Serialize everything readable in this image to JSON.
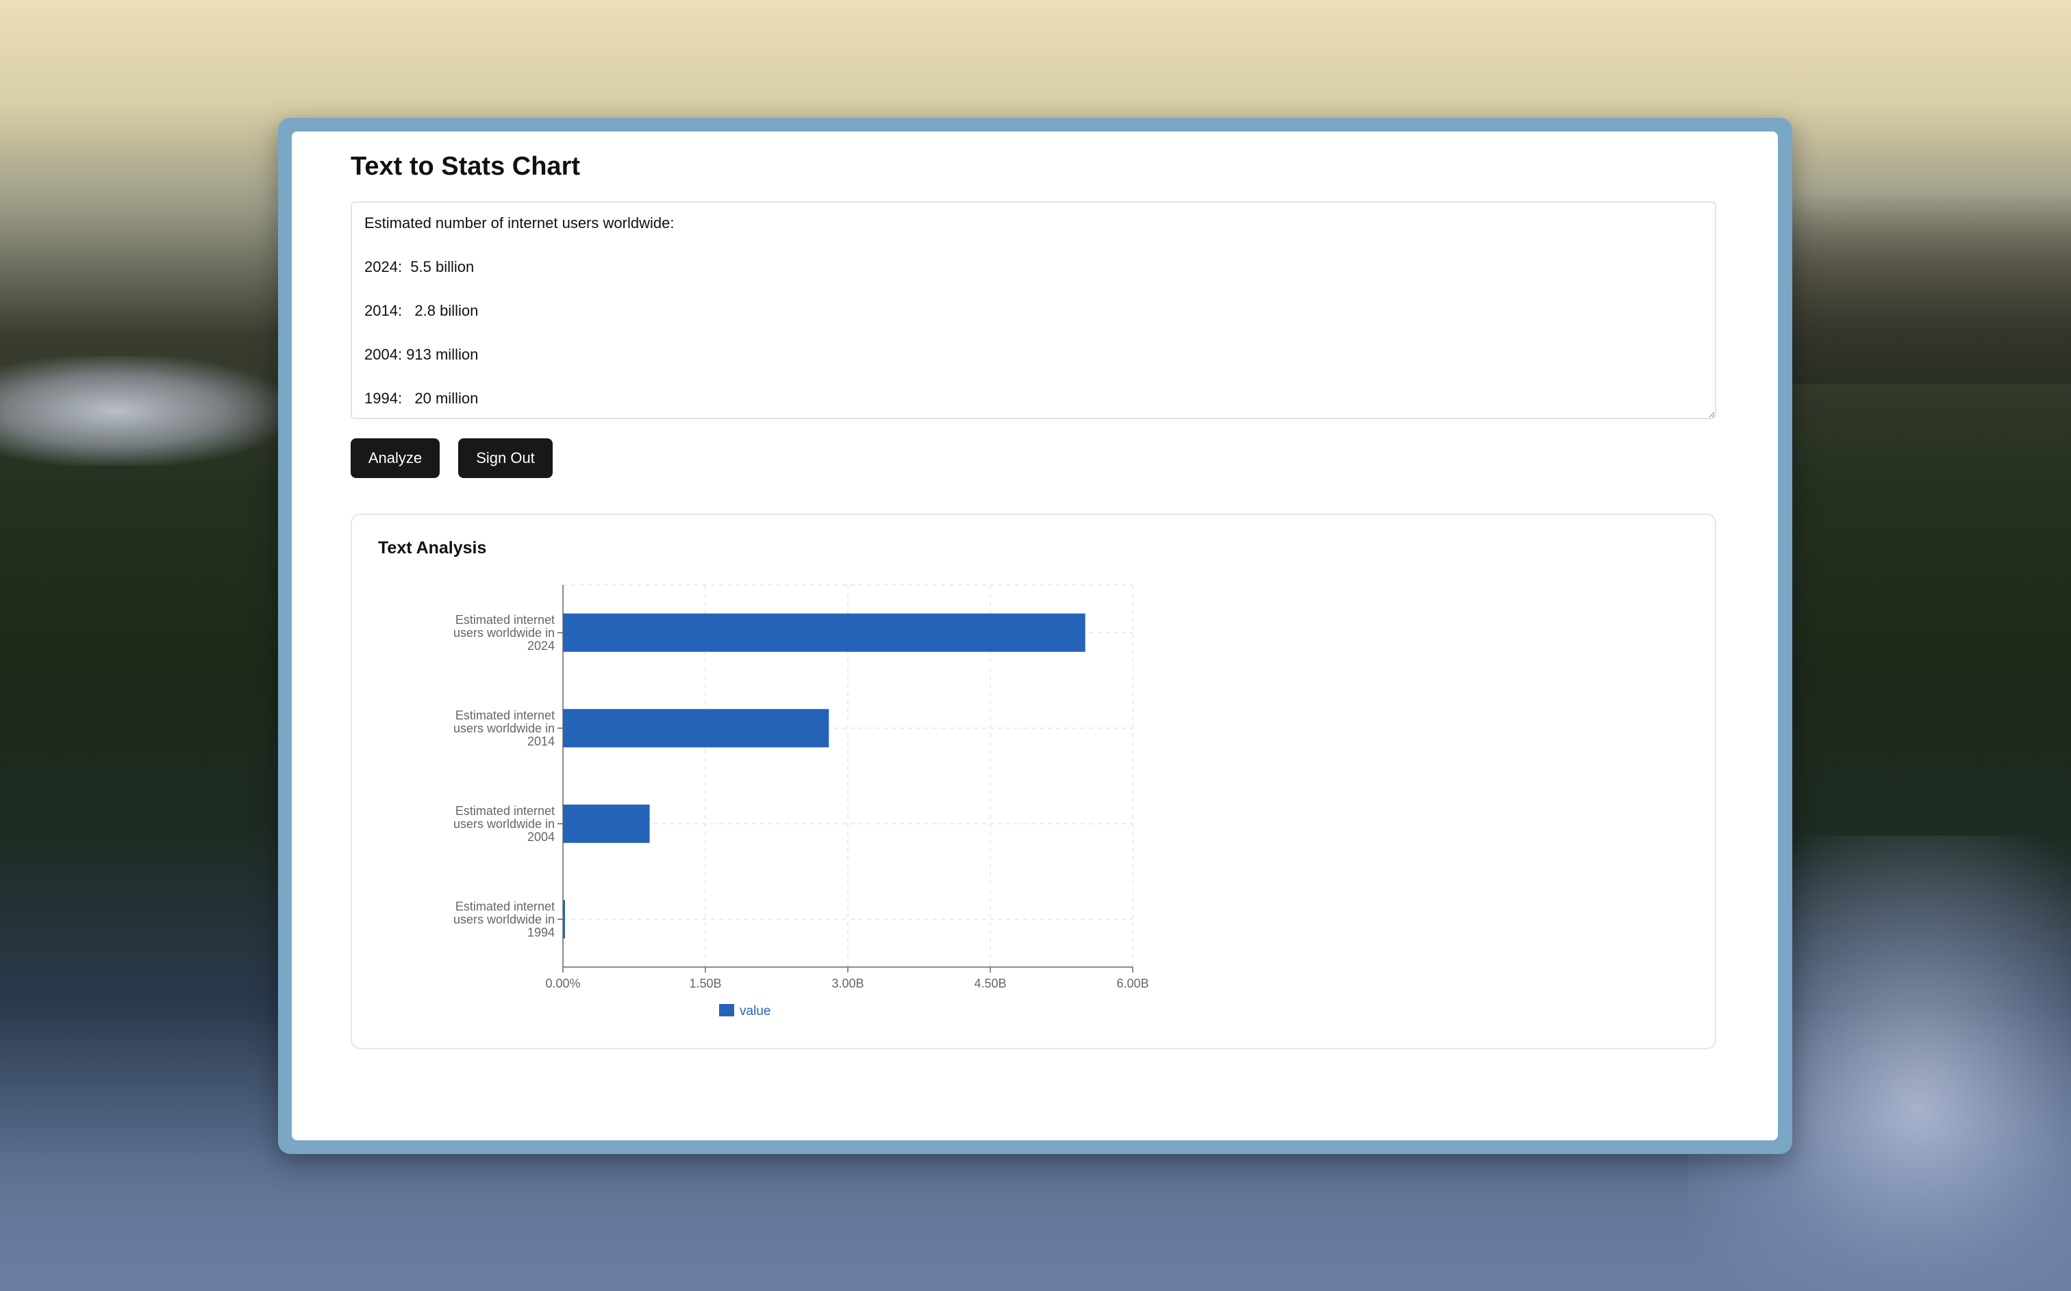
{
  "page": {
    "title": "Text to Stats Chart",
    "input_text": "Estimated number of internet users worldwide:\n\n2024:  5.5 billion\n\n2014:   2.8 billion\n\n2004: 913 million\n\n1994:   20 million",
    "analyze_label": "Analyze",
    "signout_label": "Sign Out"
  },
  "card": {
    "title": "Text Analysis"
  },
  "colors": {
    "bar": "#2563b8",
    "button_bg": "#18181b"
  },
  "chart_data": {
    "type": "bar",
    "orientation": "horizontal",
    "categories": [
      [
        "Estimated internet",
        "users worldwide in",
        "2024"
      ],
      [
        "Estimated internet",
        "users worldwide in",
        "2014"
      ],
      [
        "Estimated internet",
        "users worldwide in",
        "2004"
      ],
      [
        "Estimated internet",
        "users worldwide in",
        "1994"
      ]
    ],
    "series": [
      {
        "name": "value",
        "values": [
          5500000000,
          2800000000,
          913000000,
          20000000
        ]
      }
    ],
    "x_ticks": [
      "0.00%",
      "1.50B",
      "3.00B",
      "4.50B",
      "6.00B"
    ],
    "xlim": [
      0,
      6000000000
    ],
    "grid": true,
    "legend": "bottom"
  }
}
